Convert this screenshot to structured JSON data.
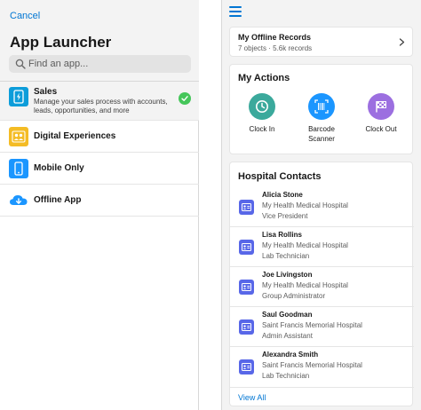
{
  "launcher": {
    "cancel_label": "Cancel",
    "title": "App Launcher",
    "search_placeholder": "Find an app...",
    "apps": [
      {
        "name": "Sales",
        "description": "Manage your sales process with accounts, leads, opportunities, and more",
        "icon": "phone-lightning-icon",
        "color": "#0d9dda",
        "selected": true
      },
      {
        "name": "Digital Experiences",
        "description": "",
        "icon": "people-icon",
        "color": "#f4bc25"
      },
      {
        "name": "Mobile Only",
        "description": "",
        "icon": "mobile-phone-icon",
        "color": "#1b96ff"
      },
      {
        "name": "Offline App",
        "description": "",
        "icon": "cloud-download-icon",
        "color": "#1b96ff"
      }
    ]
  },
  "right": {
    "offline": {
      "title": "My Offline Records",
      "subtitle": "7 objects · 5.6k records"
    },
    "actions": {
      "title": "My Actions",
      "items": [
        {
          "label": "Clock In",
          "icon": "clock-icon",
          "color": "#3ba99c"
        },
        {
          "label": "Barcode Scanner",
          "icon": "barcode-icon",
          "color": "#1b96ff"
        },
        {
          "label": "Clock Out",
          "icon": "checkered-flag-icon",
          "color": "#9c6fe0"
        }
      ]
    },
    "contacts": {
      "title": "Hospital Contacts",
      "items": [
        {
          "name": "Alicia Stone",
          "org": "My Health Medical Hospital",
          "role": "Vice President"
        },
        {
          "name": "Lisa Rollins",
          "org": "My Health Medical Hospital",
          "role": "Lab Technician"
        },
        {
          "name": "Joe Livingston",
          "org": "My Health Medical Hospital",
          "role": "Group Administrator"
        },
        {
          "name": "Saul Goodman",
          "org": "Saint Francis Memorial Hospital",
          "role": "Admin Assistant"
        },
        {
          "name": "Alexandra Smith",
          "org": "Saint Francis Memorial Hospital",
          "role": "Lab Technician"
        }
      ],
      "view_all_label": "View All"
    }
  },
  "colors": {
    "accent": "#0176d3",
    "contact_icon": "#5867e8",
    "success": "#45c65a"
  }
}
